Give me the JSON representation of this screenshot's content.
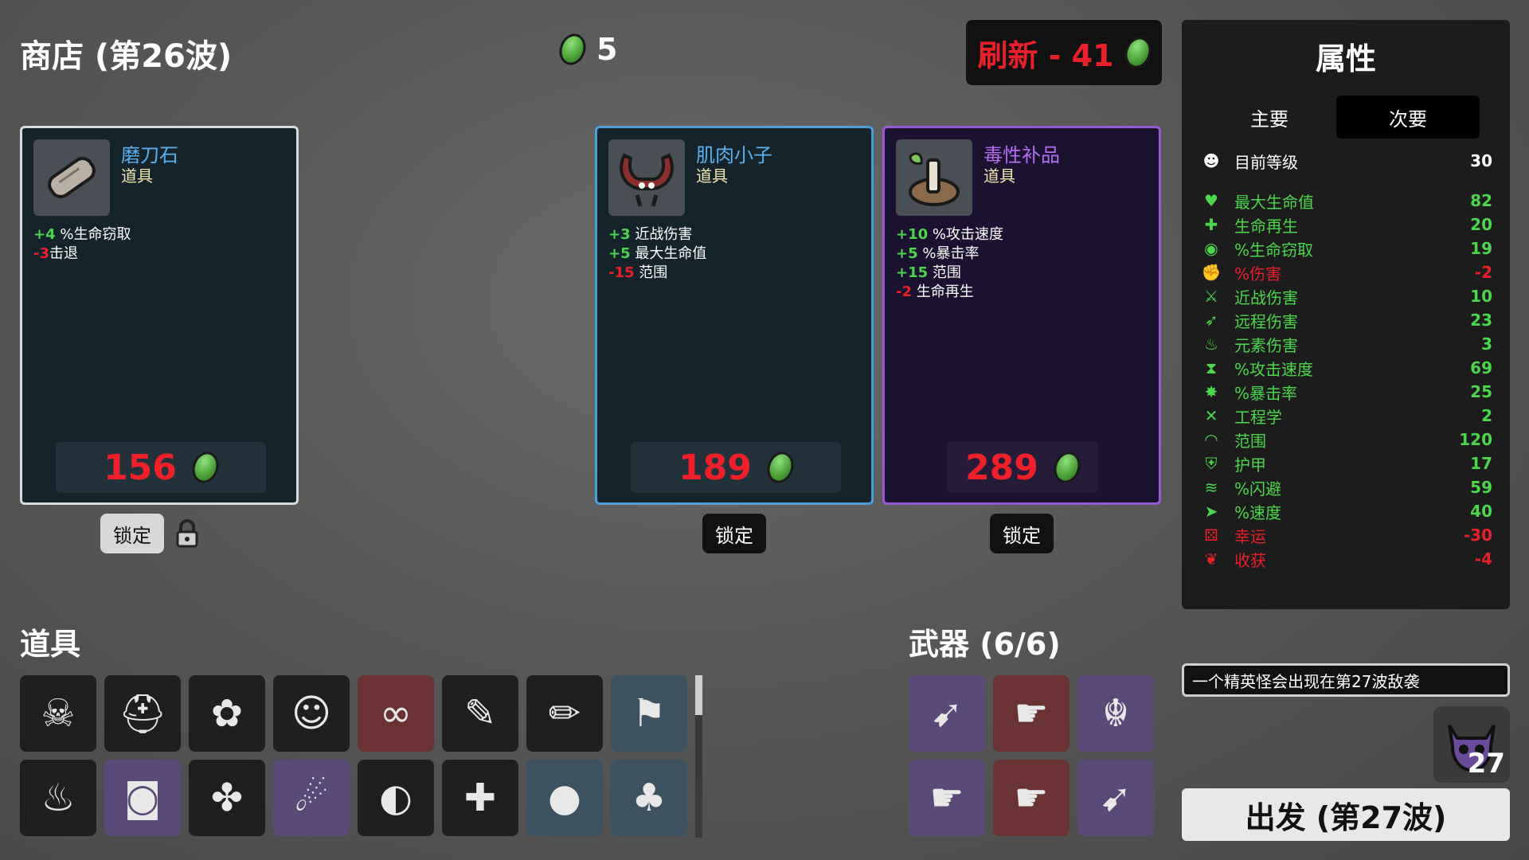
{
  "shop": {
    "title": "商店 (第26波)",
    "materials": "5",
    "refresh_label": "刷新 - 41"
  },
  "cards": [
    {
      "name": "磨刀石",
      "kind": "道具",
      "price": "156",
      "name_color": "#5ab0f0",
      "stats": [
        {
          "value": "+4",
          "text": "%生命窃取",
          "sign": "pos"
        },
        {
          "value": "-3",
          "text": "击退",
          "sign": "neg"
        }
      ],
      "lock_label": "锁定"
    },
    {
      "name": "肌肉小子",
      "kind": "道具",
      "price": "189",
      "name_color": "#5ab0f0",
      "stats": [
        {
          "value": "+3",
          "text": "近战伤害",
          "sign": "pos"
        },
        {
          "value": "+5",
          "text": "最大生命值",
          "sign": "pos"
        },
        {
          "value": "-15",
          "text": "范围",
          "sign": "neg"
        }
      ],
      "lock_label": "锁定"
    },
    {
      "name": "毒性补品",
      "kind": "道具",
      "price": "289",
      "name_color": "#b46ef0",
      "stats": [
        {
          "value": "+10",
          "text": "%攻击速度",
          "sign": "pos"
        },
        {
          "value": "+5",
          "text": "%暴击率",
          "sign": "pos"
        },
        {
          "value": "+15",
          "text": "范围",
          "sign": "pos"
        },
        {
          "value": "-2",
          "text": "生命再生",
          "sign": "neg"
        }
      ],
      "lock_label": "锁定"
    }
  ],
  "items_section": {
    "title": "道具",
    "items": [
      "goat-skull-icon",
      "helmet-icon",
      "green-slime-icon",
      "clown-face-icon",
      "binoculars-icon",
      "syringe-icon",
      "pencil-icon",
      "banner-icon",
      "cauldron-icon",
      "bucket-icon",
      "lizard-icon",
      "ghost-icon",
      "snail-shell-icon",
      "red-syringe-icon",
      "dark-blobs-icon",
      "sprout-tray-icon"
    ]
  },
  "weapons_section": {
    "title": "武器 (6/6)",
    "weapons": [
      "rocket-launcher-icon",
      "revolver-icon",
      "dragon-head-icon",
      "revolver-icon",
      "revolver-icon",
      "rocket-launcher-icon"
    ]
  },
  "stats_panel": {
    "title": "属性",
    "tab_primary": "主要",
    "tab_secondary": "次要",
    "level": {
      "label": "目前等级",
      "value": "30"
    },
    "rows": [
      {
        "label": "最大生命值",
        "value": "82",
        "color": "g",
        "icon": "♥"
      },
      {
        "label": "生命再生",
        "value": "20",
        "color": "g",
        "icon": "✚"
      },
      {
        "label": "%生命窃取",
        "value": "19",
        "color": "g",
        "icon": "◉"
      },
      {
        "label": "%伤害",
        "value": "-2",
        "color": "r",
        "icon": "✊"
      },
      {
        "label": "近战伤害",
        "value": "10",
        "color": "g",
        "icon": "⚔"
      },
      {
        "label": "远程伤害",
        "value": "23",
        "color": "g",
        "icon": "➶"
      },
      {
        "label": "元素伤害",
        "value": "3",
        "color": "g",
        "icon": "♨"
      },
      {
        "label": "%攻击速度",
        "value": "69",
        "color": "g",
        "icon": "⧗"
      },
      {
        "label": "%暴击率",
        "value": "25",
        "color": "g",
        "icon": "✸"
      },
      {
        "label": "工程学",
        "value": "2",
        "color": "g",
        "icon": "✕"
      },
      {
        "label": "范围",
        "value": "120",
        "color": "g",
        "icon": "◠"
      },
      {
        "label": "护甲",
        "value": "17",
        "color": "g",
        "icon": "⛨"
      },
      {
        "label": "%闪避",
        "value": "59",
        "color": "g",
        "icon": "≋"
      },
      {
        "label": "%速度",
        "value": "40",
        "color": "g",
        "icon": "➤"
      },
      {
        "label": "幸运",
        "value": "-30",
        "color": "r",
        "icon": "⚄"
      },
      {
        "label": "收获",
        "value": "-4",
        "color": "r",
        "icon": "❦"
      }
    ]
  },
  "elite_notice": "一个精英怪会出现在第27波敌袭",
  "next_wave_number": "27",
  "go_button": "出发 (第27波)"
}
